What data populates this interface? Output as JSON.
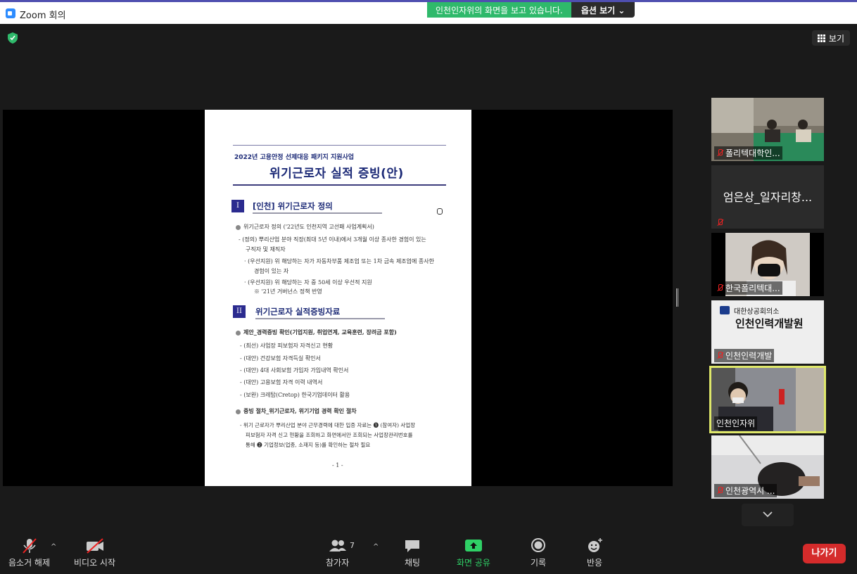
{
  "window": {
    "title": "Zoom 회의"
  },
  "banner": {
    "message": "인천인자위의 화면을 보고 있습니다.",
    "options": "옵션 보기 ⌄"
  },
  "view_button": {
    "label": "보기"
  },
  "document": {
    "header_small": "2022년 고용안정 선제대응 패키지 지원사업",
    "header_big": "위기근로자 실적 증빙(안)",
    "sections": [
      {
        "num": "I",
        "title": "[인천] 위기근로자 정의"
      },
      {
        "num": "II",
        "title": "위기근로자 실적증빙자료"
      }
    ],
    "lines": [
      "위기근로자 정의 ('22년도 인천지역 고선패 사업계획서)",
      "- (정의) 뿌리산업 분야 직장(최대 5년 이내)에서 3개월 이상 종사한 경험이 있는",
      "구직자 및 재직자",
      "· (우선지원) 위 해당하는 자가 자동차부품 제조업 또는 1차 금속 제조업에 종사한",
      "경험이 있는 자",
      "· (우선지원) 위 해당하는 자 중 50세 이상 우선적 지원",
      "※ '21년 거버넌스 정책 반영",
      "제안_경력증빙 확인(기업지원, 취업연계, 교육훈련, 장려금 포함)",
      "- (최선) 사업장 피보험자 자격신고 현황",
      "- (대안) 건강보험 자격득실 확인서",
      "- (대안) 4대 사회보험 가입자 가입내역 확인서",
      "- (대안) 고용보험 자격 이력 내역서",
      "- (보완) 크레탑(Cretop) 한국기업데이터 활용",
      "증빙 절차_위기근로자, 위기기업 경력 확인 절차",
      "- 위기 근로자가 뿌리산업 분야 근무경력에 대한 입증 자료는 ❶ (참여자) 사업장",
      "피보험자 자격 신고 현황을 조회하고 화면에서만 조회되는 사업장관리번호를",
      "통해 ❷ 기업정보(업종, 소재지 등)를 확인하는 절차 필요"
    ],
    "page": "- 1 -"
  },
  "participants": [
    {
      "name": "폴리텍대학인...",
      "muted": true
    },
    {
      "name": "엄은상_일자리창...",
      "muted": true
    },
    {
      "name": "한국폴리텍대...",
      "muted": true
    },
    {
      "name": "인천인력개발",
      "muted": true,
      "logo_org": "대한상공회의소",
      "logo_title": "인천인력개발원"
    },
    {
      "name": "인천인자위",
      "muted": false,
      "active": true
    },
    {
      "name": "인천광역시 ...",
      "muted": true
    }
  ],
  "toolbar": {
    "mute": "음소거 해제",
    "video": "비디오 시작",
    "participants": "참가자",
    "participant_count": "7",
    "chat": "채팅",
    "share": "화면 공유",
    "record": "기록",
    "reactions": "반응",
    "leave": "나가기"
  },
  "colors": {
    "accent_green": "#2fb96b",
    "leave_red": "#d52b2b",
    "active_border": "#dfe86a",
    "doc_blue": "#1c2a77"
  }
}
